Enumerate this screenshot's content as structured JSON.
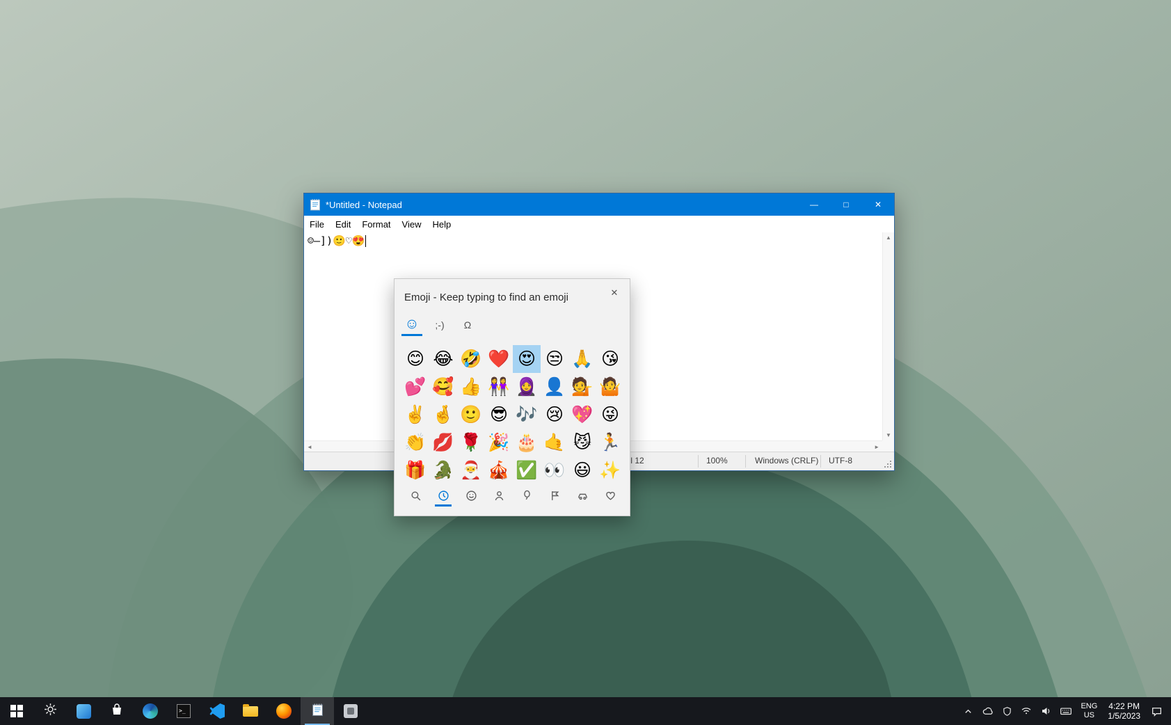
{
  "colors": {
    "accent": "#0078d7",
    "title_bar": "#0078d7",
    "emoji_selection": "#a5d3f3",
    "taskbar": "#16181d"
  },
  "notepad": {
    "title": "*Untitled - Notepad",
    "menus": [
      "File",
      "Edit",
      "Format",
      "View",
      "Help"
    ],
    "content": "☺—])🙂♡😍",
    "controls": {
      "minimize": "—",
      "maximize": "□",
      "close": "✕"
    },
    "scrollbar": {
      "up": "▲",
      "down": "▼",
      "left": "◄",
      "right": "►"
    },
    "status": {
      "cursor_position": "Ln 1, Col 12",
      "zoom": "100%",
      "line_ending": "Windows (CRLF)",
      "encoding": "UTF-8"
    }
  },
  "emoji_panel": {
    "title": "Emoji - Keep typing to find an emoji",
    "close_label": "✕",
    "tabs": [
      {
        "name": "emoji",
        "label": "☺",
        "selected": true
      },
      {
        "name": "kaomoji",
        "label": ";-)",
        "selected": false
      },
      {
        "name": "symbols",
        "label": "Ω",
        "selected": false
      }
    ],
    "selected_index": 4,
    "grid": [
      "😊",
      "😂",
      "🤣",
      "❤️",
      "😍",
      "😒",
      "🙏",
      "😘",
      "💕",
      "🥰",
      "👍",
      "👭",
      "🧕",
      "👤",
      "💁",
      "🤷",
      "✌️",
      "🤞",
      "🙂",
      "😎",
      "🎶",
      "😢",
      "💖",
      "😜",
      "👏",
      "💋",
      "🌹",
      "🎉",
      "🎂",
      "🤙",
      "😼",
      "🏃",
      "🎁",
      "🐊",
      "🎅",
      "🎪",
      "✅",
      "👀",
      "😃",
      "✨"
    ],
    "categories": [
      {
        "name": "search",
        "selected": false
      },
      {
        "name": "recently-used",
        "selected": true
      },
      {
        "name": "smileys",
        "selected": false
      },
      {
        "name": "people",
        "selected": false
      },
      {
        "name": "celebrations",
        "selected": false
      },
      {
        "name": "flags",
        "selected": false
      },
      {
        "name": "transportation",
        "selected": false
      },
      {
        "name": "symbols",
        "selected": false
      }
    ]
  },
  "taskbar": {
    "apps": [
      "start",
      "settings",
      "photos",
      "store",
      "edge",
      "terminal",
      "vscode",
      "file-explorer",
      "firefox",
      "notepad",
      "paint"
    ],
    "active_app": "notepad",
    "tray": {
      "language_line1": "ENG",
      "language_line2": "US",
      "time": "4:22 PM",
      "date": "1/5/2023"
    }
  }
}
